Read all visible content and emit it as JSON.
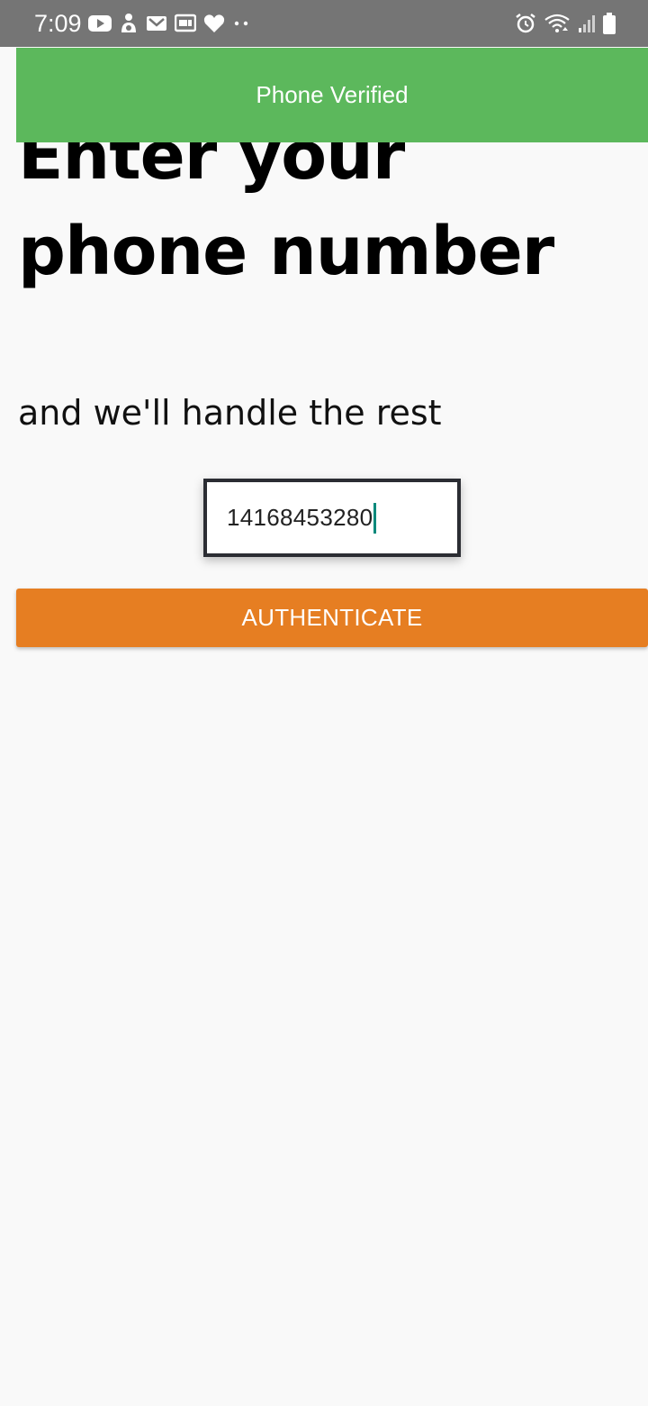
{
  "status_bar": {
    "time": "7:09",
    "left_icons": [
      "youtube-icon",
      "app-icon",
      "gmail-icon",
      "wallet-icon",
      "heart-icon",
      "more-dots-icon"
    ],
    "right_icons": [
      "alarm-icon",
      "wifi-icon",
      "signal-icon",
      "battery-icon"
    ]
  },
  "toast": {
    "message": "Phone Verified",
    "color": "#5cb85c"
  },
  "main": {
    "title": "Enter your phone number",
    "subtitle": "and we'll handle the rest",
    "phone_input": {
      "value": "14168453280"
    },
    "authenticate_label": "AUTHENTICATE",
    "button_color": "#e67e22"
  }
}
